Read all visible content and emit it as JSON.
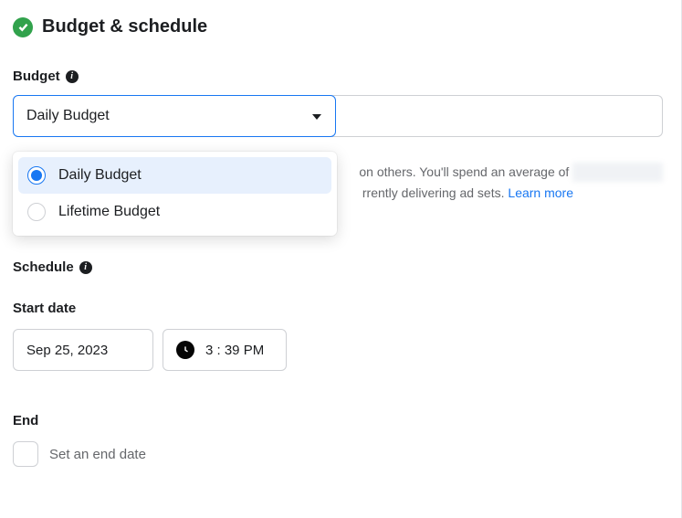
{
  "header": {
    "title": "Budget & schedule"
  },
  "budget": {
    "label": "Budget",
    "selected_value": "Daily Budget",
    "options": {
      "daily": "Daily Budget",
      "lifetime": "Lifetime Budget"
    },
    "help_line1_tail": "on others. You'll spend an average of",
    "help_line1_blur": "xxxxxx xxx xxxx",
    "help_line2_mid": "rrently delivering ad sets.",
    "learn_more": "Learn more"
  },
  "schedule": {
    "label": "Schedule",
    "start": {
      "label": "Start date",
      "date": "Sep 25, 2023",
      "time": "3 : 39 PM"
    },
    "end": {
      "label": "End",
      "checkbox_label": "Set an end date",
      "checked": false
    }
  }
}
